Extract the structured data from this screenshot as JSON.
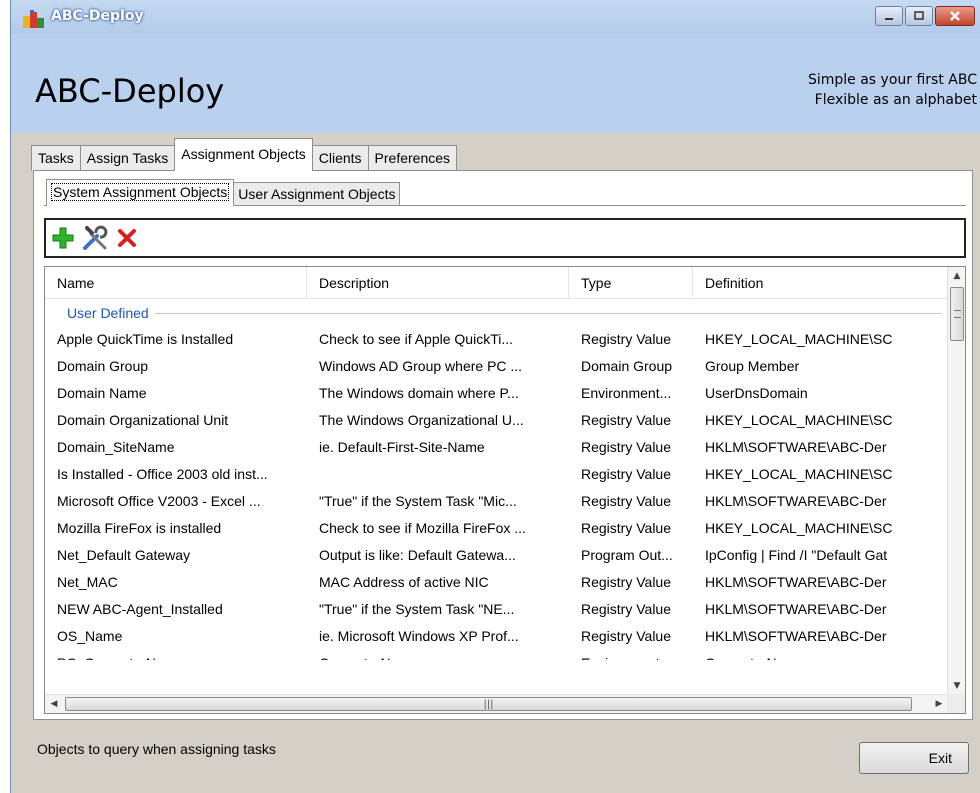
{
  "window": {
    "title": "ABC-Deploy"
  },
  "header": {
    "brand": "ABC-Deploy",
    "tagline_line1": "Simple as your first ABC",
    "tagline_line2": "Flexible as an alphabet"
  },
  "tabs": [
    {
      "label": "Tasks",
      "active": false
    },
    {
      "label": "Assign Tasks",
      "active": false
    },
    {
      "label": "Assignment Objects",
      "active": true
    },
    {
      "label": "Clients",
      "active": false
    },
    {
      "label": "Preferences",
      "active": false
    }
  ],
  "subtabs": [
    {
      "label": "System Assignment Objects",
      "active": true
    },
    {
      "label": "User Assignment Objects",
      "active": false
    }
  ],
  "toolbar": {
    "add_icon": "plus-icon",
    "edit_icon": "tools-icon",
    "delete_icon": "delete-icon"
  },
  "list": {
    "columns": [
      "Name",
      "Description",
      "Type",
      "Definition"
    ],
    "group": "User Defined",
    "rows": [
      [
        "Apple QuickTime is Installed",
        "Check to see if Apple QuickTi...",
        "Registry Value",
        "HKEY_LOCAL_MACHINE\\SC"
      ],
      [
        "Domain Group",
        "Windows AD Group where PC ...",
        "Domain Group",
        "Group Member"
      ],
      [
        "Domain Name",
        "The Windows domain where P...",
        "Environment...",
        "UserDnsDomain"
      ],
      [
        "Domain Organizational Unit",
        "The Windows Organizational U...",
        "Registry Value",
        "HKEY_LOCAL_MACHINE\\SC"
      ],
      [
        "Domain_SiteName",
        "ie. Default-First-Site-Name",
        "Registry Value",
        "HKLM\\SOFTWARE\\ABC-Der"
      ],
      [
        "Is Installed - Office 2003 old inst...",
        "",
        "Registry Value",
        "HKEY_LOCAL_MACHINE\\SC"
      ],
      [
        "Microsoft Office V2003 - Excel ...",
        "\"True\" if the System Task \"Mic...",
        "Registry Value",
        "HKLM\\SOFTWARE\\ABC-Der"
      ],
      [
        "Mozilla FireFox is installed",
        "Check to see if Mozilla FireFox ...",
        "Registry Value",
        "HKEY_LOCAL_MACHINE\\SC"
      ],
      [
        "Net_Default Gateway",
        "Output is like:  Default Gatewa...",
        "Program Out...",
        "IpConfig | Find /I \"Default Gat"
      ],
      [
        "Net_MAC",
        "MAC Address of active NIC",
        "Registry Value",
        "HKLM\\SOFTWARE\\ABC-Der"
      ],
      [
        "NEW ABC-Agent_Installed",
        "\"True\" if the System Task \"NE...",
        "Registry Value",
        "HKLM\\SOFTWARE\\ABC-Der"
      ],
      [
        "OS_Name",
        "ie. Microsoft Windows XP Prof...",
        "Registry Value",
        "HKLM\\SOFTWARE\\ABC-Der"
      ],
      [
        "PC_ComputerName",
        "ComputerName",
        "Environment...",
        "ComputerName"
      ]
    ]
  },
  "status": {
    "text": "Objects to query when assigning tasks"
  },
  "buttons": {
    "exit": "Exit"
  }
}
